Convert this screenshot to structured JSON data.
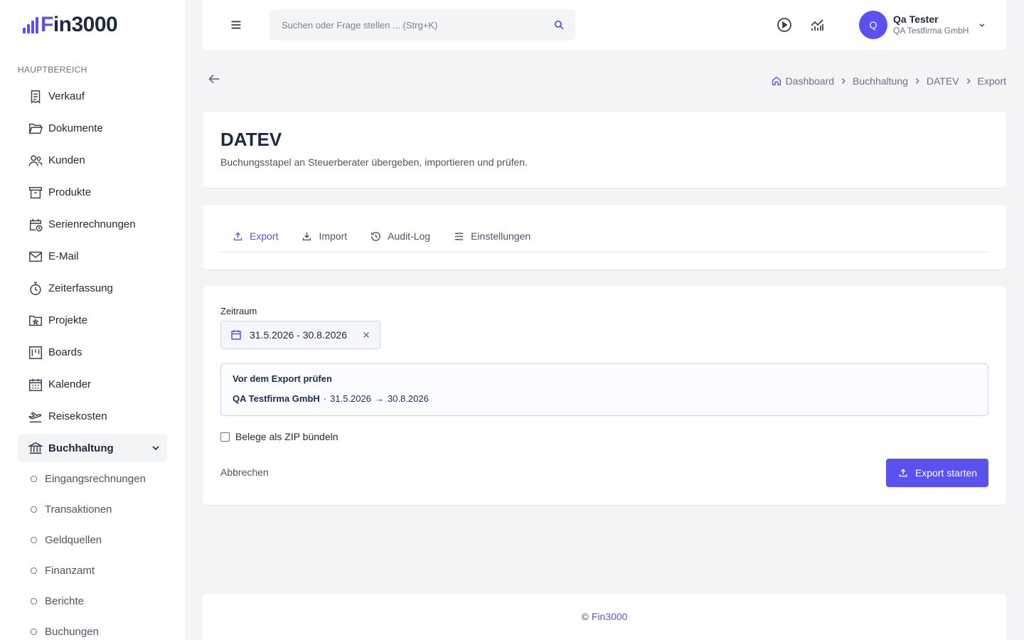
{
  "app": {
    "logo_text_f": "F",
    "logo_text_rest": "in3000",
    "brand_color": "#5b50f0"
  },
  "sidebar": {
    "section_label": "HAUPTBEREICH",
    "items": [
      {
        "label": "Verkauf",
        "icon": "receipt-icon"
      },
      {
        "label": "Dokumente",
        "icon": "folder-open-icon"
      },
      {
        "label": "Kunden",
        "icon": "users-icon"
      },
      {
        "label": "Produkte",
        "icon": "archive-icon"
      },
      {
        "label": "Serienrechnungen",
        "icon": "calendar-clock-icon"
      },
      {
        "label": "E-Mail",
        "icon": "mail-icon"
      },
      {
        "label": "Zeiterfassung",
        "icon": "stopwatch-icon"
      },
      {
        "label": "Projekte",
        "icon": "folder-star-icon"
      },
      {
        "label": "Boards",
        "icon": "kanban-icon"
      },
      {
        "label": "Kalender",
        "icon": "calendar-grid-icon"
      },
      {
        "label": "Reisekosten",
        "icon": "plane-departure-icon"
      },
      {
        "label": "Buchhaltung",
        "icon": "bank-icon",
        "active": true,
        "expanded": true
      }
    ],
    "subitems": [
      {
        "label": "Eingangsrechnungen"
      },
      {
        "label": "Transaktionen"
      },
      {
        "label": "Geldquellen"
      },
      {
        "label": "Finanzamt"
      },
      {
        "label": "Berichte"
      },
      {
        "label": "Buchungen"
      }
    ]
  },
  "topbar": {
    "search_placeholder": "Suchen oder Frage stellen ... (Strg+K)",
    "user": {
      "initial": "Q",
      "name": "Qa Tester",
      "company": "QA Testfirma GmbH"
    }
  },
  "breadcrumb": [
    "Dashboard",
    "Buchhaltung",
    "DATEV",
    "Export"
  ],
  "header": {
    "title": "DATEV",
    "subtitle": "Buchungsstapel an Steuerberater übergeben, importieren und prüfen."
  },
  "tabs": [
    {
      "label": "Export",
      "icon": "upload-icon",
      "active": true
    },
    {
      "label": "Import",
      "icon": "download-icon"
    },
    {
      "label": "Audit-Log",
      "icon": "history-icon"
    },
    {
      "label": "Einstellungen",
      "icon": "sliders-icon"
    }
  ],
  "form": {
    "period_label": "Zeitraum",
    "period_value": "31.5.2026 - 30.8.2026",
    "info_title": "Vor dem Export prüfen",
    "info_company": "QA Testfirma GmbH",
    "info_sep": "·",
    "info_start": "31.5.2026",
    "info_arrow": "→",
    "info_end": "30.8.2026",
    "zip_label": "Belege als ZIP bündeln",
    "zip_checked": false,
    "cancel_label": "Abbrechen",
    "submit_label": "Export starten"
  },
  "footer": {
    "copyright": "©",
    "link": "Fin3000"
  }
}
